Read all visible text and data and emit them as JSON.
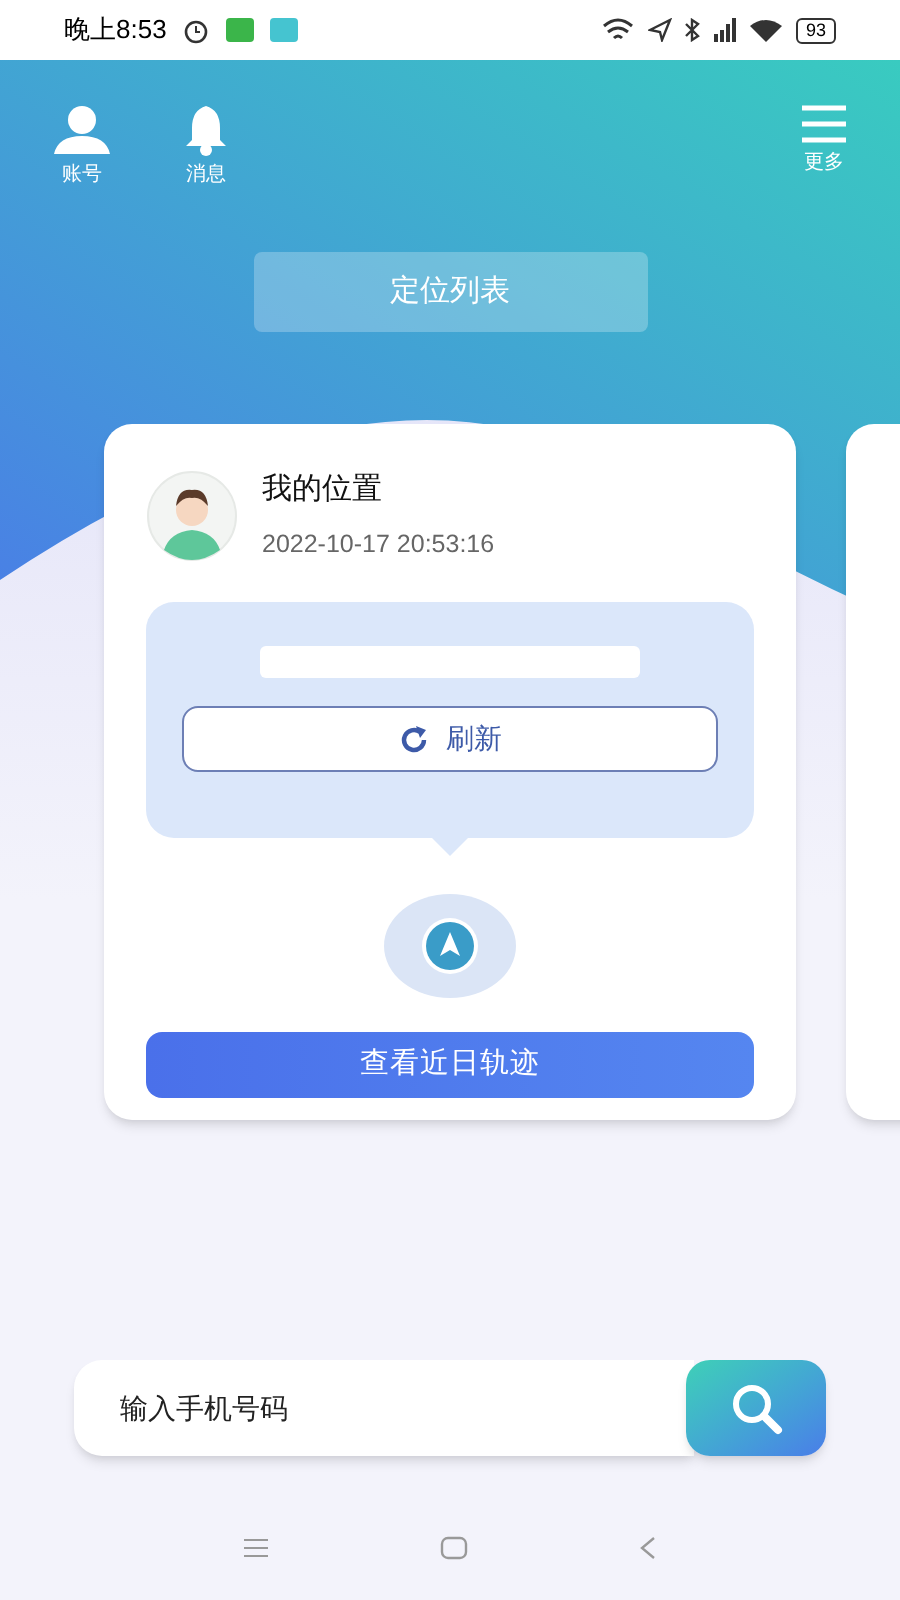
{
  "status_bar": {
    "time": "晚上8:53",
    "battery": "93"
  },
  "top_bar": {
    "items": [
      {
        "kind": "account",
        "label": "账号"
      },
      {
        "kind": "message",
        "label": "消息"
      },
      {
        "kind": "more",
        "label": "更多"
      }
    ]
  },
  "title_button": "定位列表",
  "card": {
    "name": "我的位置",
    "timestamp": "2022-10-17 20:53:16",
    "refresh_button": "刷新",
    "track_button": "查看近日轨迹"
  },
  "search": {
    "placeholder": "输入手机号码"
  }
}
